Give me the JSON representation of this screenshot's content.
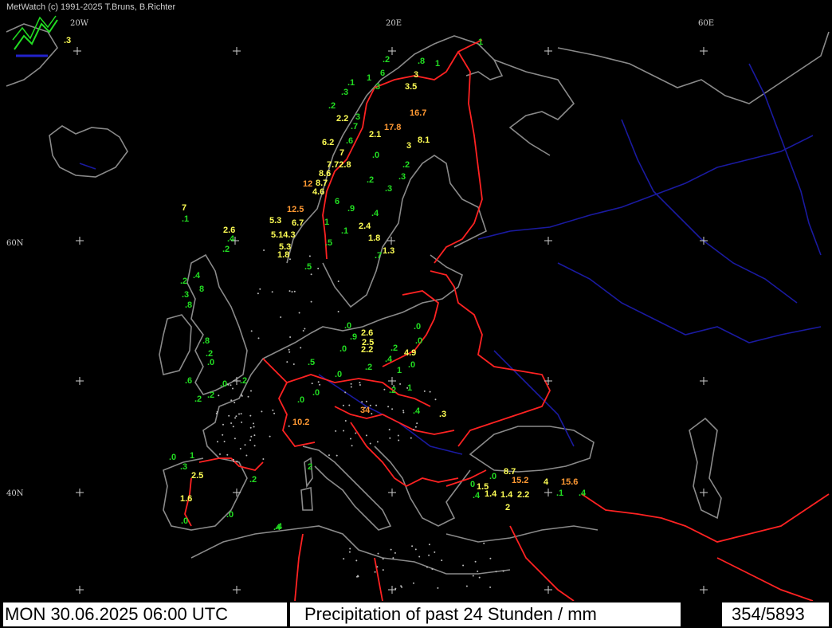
{
  "credit": "MetWatch  (c) 1991-2025 T.Bruns, B.Richter",
  "footer": {
    "datetime": "MON 30.06.2025 06:00 UTC",
    "title": "Precipitation of past  24 Stunden  / mm",
    "count": "354/5893"
  },
  "grid_labels": [
    {
      "text": "20W"
    },
    {
      "text": "20E"
    },
    {
      "text": "60E"
    },
    {
      "text": "60N"
    },
    {
      "text": "40N"
    }
  ],
  "colors": {
    "green": "#22dd22",
    "yellow": "#ffff55",
    "orange": "#ff9933",
    "border": "#ff2222",
    "coast": "#8a8a8a",
    "river": "#1a1aa0"
  },
  "observations": [
    {
      "v": ".3",
      "c": "yellow"
    },
    {
      "v": "1",
      "c": "green"
    },
    {
      "v": ".2",
      "c": "green"
    },
    {
      "v": ".8",
      "c": "green"
    },
    {
      "v": "6",
      "c": "green"
    },
    {
      "v": "3",
      "c": "yellow"
    },
    {
      "v": "1",
      "c": "green"
    },
    {
      "v": ".1",
      "c": "green"
    },
    {
      "v": "1",
      "c": "green"
    },
    {
      "v": ".3",
      "c": "green"
    },
    {
      "v": "3.5",
      "c": "yellow"
    },
    {
      "v": ".3",
      "c": "green"
    },
    {
      "v": ".2",
      "c": "green"
    },
    {
      "v": "16.7",
      "c": "orange"
    },
    {
      "v": "2.2",
      "c": "yellow"
    },
    {
      "v": "3",
      "c": "green"
    },
    {
      "v": "17.8",
      "c": "orange"
    },
    {
      "v": ".7",
      "c": "green"
    },
    {
      "v": "2.1",
      "c": "yellow"
    },
    {
      "v": "6.2",
      "c": "yellow"
    },
    {
      "v": ".6",
      "c": "green"
    },
    {
      "v": "3",
      "c": "yellow"
    },
    {
      "v": "8.1",
      "c": "yellow"
    },
    {
      "v": "7",
      "c": "yellow"
    },
    {
      "v": ".0",
      "c": "green"
    },
    {
      "v": "7.72.8",
      "c": "yellow"
    },
    {
      "v": ".2",
      "c": "green"
    },
    {
      "v": "8.6",
      "c": "yellow"
    },
    {
      "v": ".3",
      "c": "green"
    },
    {
      "v": "12",
      "c": "orange"
    },
    {
      "v": "8.7",
      "c": "yellow"
    },
    {
      "v": ".2",
      "c": "green"
    },
    {
      "v": "4.6",
      "c": "yellow"
    },
    {
      "v": ".3",
      "c": "green"
    },
    {
      "v": "6",
      "c": "green"
    },
    {
      "v": "12.5",
      "c": "orange"
    },
    {
      "v": ".9",
      "c": "green"
    },
    {
      "v": "7",
      "c": "yellow"
    },
    {
      "v": ".4",
      "c": "green"
    },
    {
      "v": "5.3",
      "c": "yellow"
    },
    {
      "v": "6.7",
      "c": "yellow"
    },
    {
      "v": "1",
      "c": "green"
    },
    {
      "v": ".1",
      "c": "green"
    },
    {
      "v": "2.6",
      "c": "yellow"
    },
    {
      "v": "2.4",
      "c": "yellow"
    },
    {
      "v": ".1",
      "c": "green"
    },
    {
      "v": "5.14.3",
      "c": "yellow"
    },
    {
      "v": ".4",
      "c": "green"
    },
    {
      "v": "1.8",
      "c": "yellow"
    },
    {
      "v": ".5",
      "c": "green"
    },
    {
      "v": "5.3",
      "c": "yellow"
    },
    {
      "v": ".2",
      "c": "green"
    },
    {
      "v": "1.3",
      "c": "yellow"
    },
    {
      "v": "1.8",
      "c": "yellow"
    },
    {
      "v": ".7",
      "c": "green"
    },
    {
      "v": ".5",
      "c": "green"
    },
    {
      "v": ".4",
      "c": "green"
    },
    {
      "v": ".2",
      "c": "green"
    },
    {
      "v": "8",
      "c": "green"
    },
    {
      "v": ".3",
      "c": "green"
    },
    {
      "v": ".8",
      "c": "green"
    },
    {
      "v": ".0",
      "c": "green"
    },
    {
      "v": "2.6",
      "c": "yellow"
    },
    {
      "v": ".0",
      "c": "green"
    },
    {
      "v": ".9",
      "c": "green"
    },
    {
      "v": "2.5",
      "c": "yellow"
    },
    {
      "v": ".2",
      "c": "green"
    },
    {
      "v": ".0",
      "c": "green"
    },
    {
      "v": ".8",
      "c": "green"
    },
    {
      "v": ".0",
      "c": "green"
    },
    {
      "v": "2.2",
      "c": "yellow"
    },
    {
      "v": ".2",
      "c": "green"
    },
    {
      "v": "4.9",
      "c": "yellow"
    },
    {
      "v": ".4",
      "c": "green"
    },
    {
      "v": ".0",
      "c": "green"
    },
    {
      "v": ".5",
      "c": "green"
    },
    {
      "v": ".0",
      "c": "green"
    },
    {
      "v": ".2",
      "c": "green"
    },
    {
      "v": "1",
      "c": "green"
    },
    {
      "v": ".0",
      "c": "green"
    },
    {
      "v": ".2",
      "c": "green"
    },
    {
      "v": ".0",
      "c": "green"
    },
    {
      "v": ".6",
      "c": "green"
    },
    {
      "v": ".2",
      "c": "green"
    },
    {
      "v": ".3",
      "c": "yellow"
    },
    {
      "v": "2",
      "c": "green"
    },
    {
      "v": ".2",
      "c": "green"
    },
    {
      "v": ".0",
      "c": "green"
    },
    {
      "v": "1",
      "c": "green"
    },
    {
      "v": ".2",
      "c": "green"
    },
    {
      "v": ".0",
      "c": "green"
    },
    {
      "v": "34",
      "c": "orange"
    },
    {
      "v": ".4",
      "c": "green"
    },
    {
      "v": ".3",
      "c": "green"
    },
    {
      "v": "10.2",
      "c": "orange"
    },
    {
      "v": ".0",
      "c": "green"
    },
    {
      "v": "1",
      "c": "green"
    },
    {
      "v": ".2",
      "c": "green"
    },
    {
      "v": ".4",
      "c": "green"
    },
    {
      "v": "8.7",
      "c": "yellow"
    },
    {
      "v": "2.5",
      "c": "yellow"
    },
    {
      "v": ".0",
      "c": "green"
    },
    {
      "v": "0",
      "c": "green"
    },
    {
      "v": "15.2",
      "c": "orange"
    },
    {
      "v": "4",
      "c": "yellow"
    },
    {
      "v": "15.6",
      "c": "orange"
    },
    {
      "v": "1.5",
      "c": "yellow"
    },
    {
      "v": ".4",
      "c": "green"
    },
    {
      "v": "1.4",
      "c": "yellow"
    },
    {
      "v": "1.4",
      "c": "yellow"
    },
    {
      "v": "2.2",
      "c": "yellow"
    },
    {
      "v": ".1",
      "c": "green"
    },
    {
      "v": ".4",
      "c": "green"
    },
    {
      "v": "1.6",
      "c": "yellow"
    },
    {
      "v": "2",
      "c": "yellow"
    },
    {
      "v": ".0",
      "c": "green"
    },
    {
      "v": ".0",
      "c": "green"
    },
    {
      "v": ".4",
      "c": "green"
    }
  ]
}
